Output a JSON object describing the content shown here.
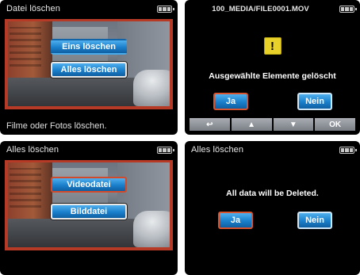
{
  "colors": {
    "accent_blue": "#1a7fcb",
    "selection_red": "#d24a2a",
    "warning_yellow": "#e8d22a",
    "screen_bg": "#000000"
  },
  "panel1": {
    "title": "Datei löschen",
    "battery_icon": "battery-full-icon",
    "buttons": [
      "Eins löschen",
      "Alles löschen"
    ],
    "footer": "Filme oder Fotos löschen."
  },
  "panel2": {
    "title": "100_MEDIA/FILE0001.MOV",
    "battery_icon": "battery-full-icon",
    "warning_icon": "exclamation-icon",
    "warning_glyph": "!",
    "message": "Ausgewählte Elemente gelöscht",
    "yes": "Ja",
    "no": "Nein",
    "nav": {
      "back": "↩",
      "up": "▲",
      "down": "▼",
      "ok": "OK"
    }
  },
  "panel3": {
    "title": "Alles löschen",
    "battery_icon": "battery-full-icon",
    "buttons": [
      "Videodatei",
      "Bilddatei"
    ]
  },
  "panel4": {
    "title": "Alles löschen",
    "battery_icon": "battery-full-icon",
    "message": "All data will be Deleted.",
    "yes": "Ja",
    "no": "Nein"
  }
}
